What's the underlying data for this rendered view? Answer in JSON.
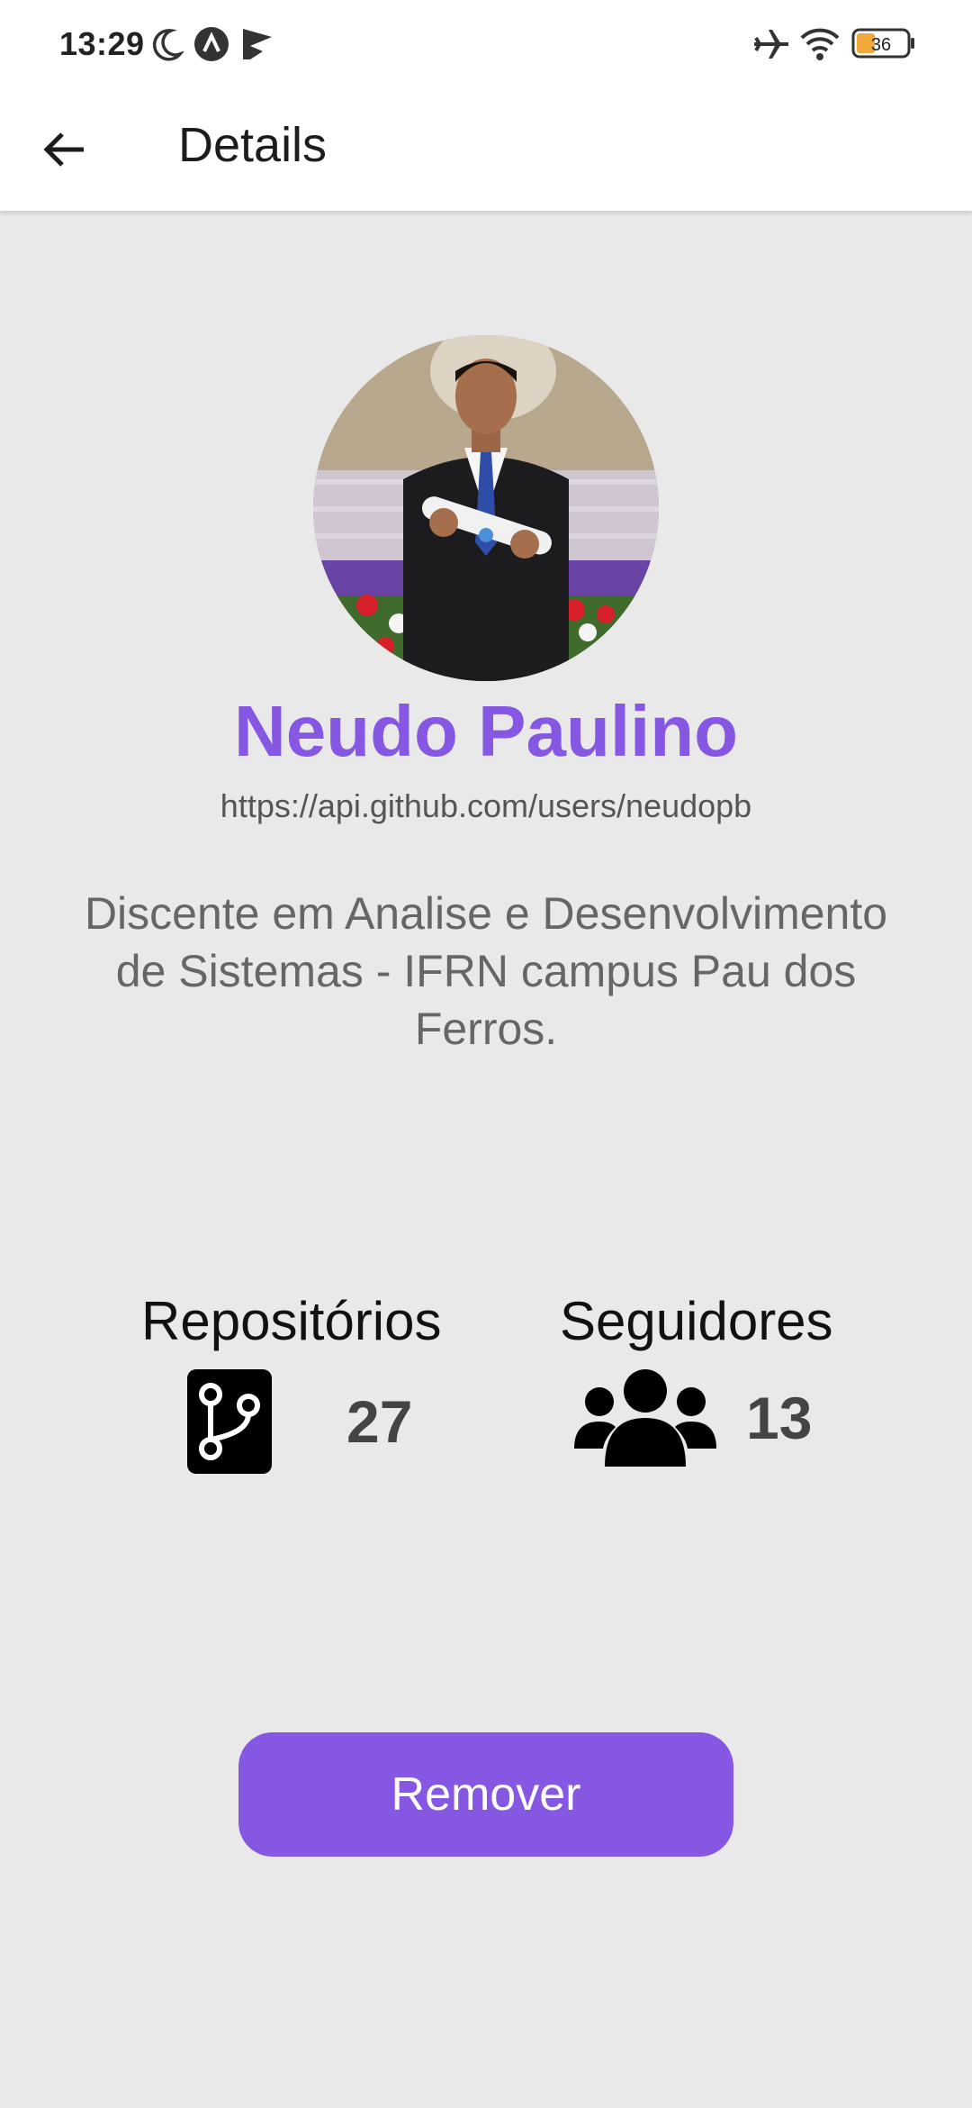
{
  "status_bar": {
    "time": "13:29",
    "battery": "36",
    "icons": [
      "moon-icon",
      "app-a-icon",
      "play-store-icon",
      "airplane-icon",
      "wifi-icon",
      "battery-icon"
    ]
  },
  "app_bar": {
    "title": "Details",
    "back_icon": "arrow-left-icon"
  },
  "profile": {
    "name": "Neudo Paulino",
    "url": "https://api.github.com/users/neudopb",
    "bio": "Discente em Analise e Desenvolvimento de Sistemas - IFRN campus Pau dos Ferros.",
    "avatar_icon": "user-photo"
  },
  "stats": {
    "repos_label": "Repositórios",
    "repos_value": "27",
    "repos_icon": "git-branch-icon",
    "followers_label": "Seguidores",
    "followers_value": "13",
    "followers_icon": "users-group-icon"
  },
  "actions": {
    "remove_label": "Remover"
  },
  "colors": {
    "accent": "#8557e3",
    "background": "#e9e9ea",
    "surface": "#ffffff"
  }
}
